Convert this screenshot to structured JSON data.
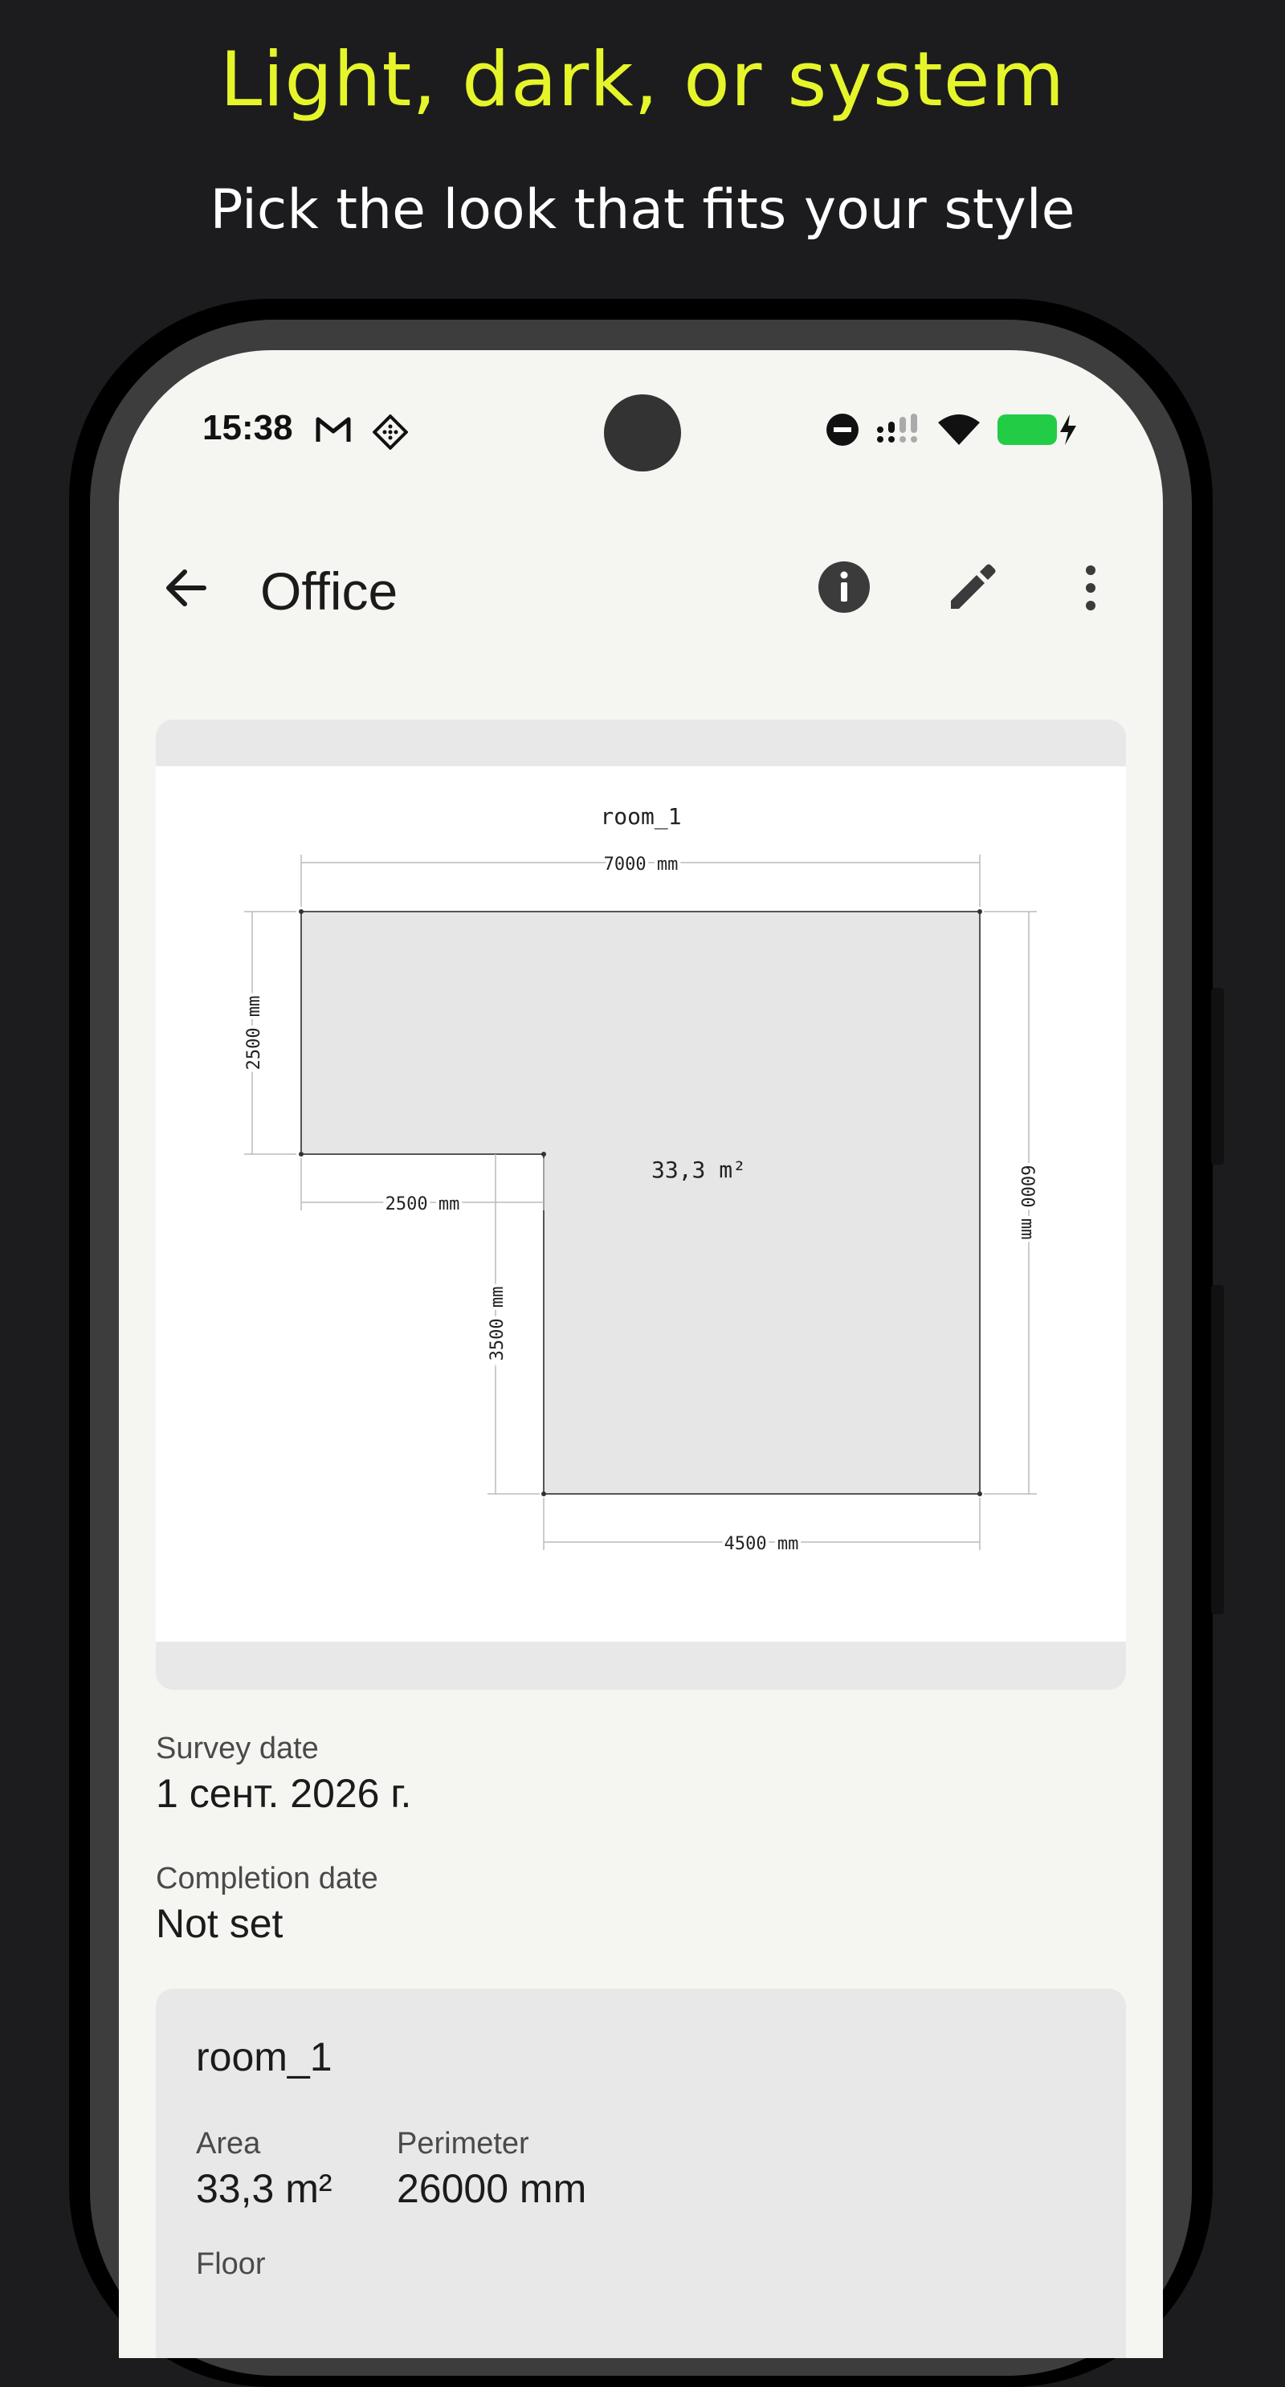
{
  "promo": {
    "title": "Light, dark, or system",
    "subtitle": "Pick the look that fits your style"
  },
  "status_bar": {
    "time": "15:38",
    "left_icons": [
      "gmail-icon",
      "app-notification-icon"
    ],
    "right_icons": [
      "do-not-disturb-icon",
      "signal-icon",
      "wifi-icon",
      "battery-charging-icon"
    ]
  },
  "app_bar": {
    "title": "Office",
    "actions": [
      "back-arrow-icon",
      "info-icon",
      "edit-pencil-icon",
      "more-vert-icon"
    ]
  },
  "floor_plan": {
    "room_label": "room_1",
    "area_label": "33,3 m²",
    "dimensions": {
      "top": "7000 mm",
      "left": "2500 mm",
      "notch_horizontal": "2500 mm",
      "notch_vertical": "3500 mm",
      "bottom": "4500 mm",
      "right": "6000 mm"
    }
  },
  "details": {
    "survey_date_label": "Survey date",
    "survey_date_value": "1 сент. 2026 г.",
    "completion_date_label": "Completion date",
    "completion_date_value": "Not set"
  },
  "room_card": {
    "name": "room_1",
    "area_label": "Area",
    "area_value": "33,3 m²",
    "perimeter_label": "Perimeter",
    "perimeter_value": "26000 mm",
    "floor_label": "Floor"
  },
  "colors": {
    "promo_title": "#e6f52a",
    "battery": "#22cc44",
    "background": "#1c1c1e",
    "screen": "#f5f5f2"
  }
}
